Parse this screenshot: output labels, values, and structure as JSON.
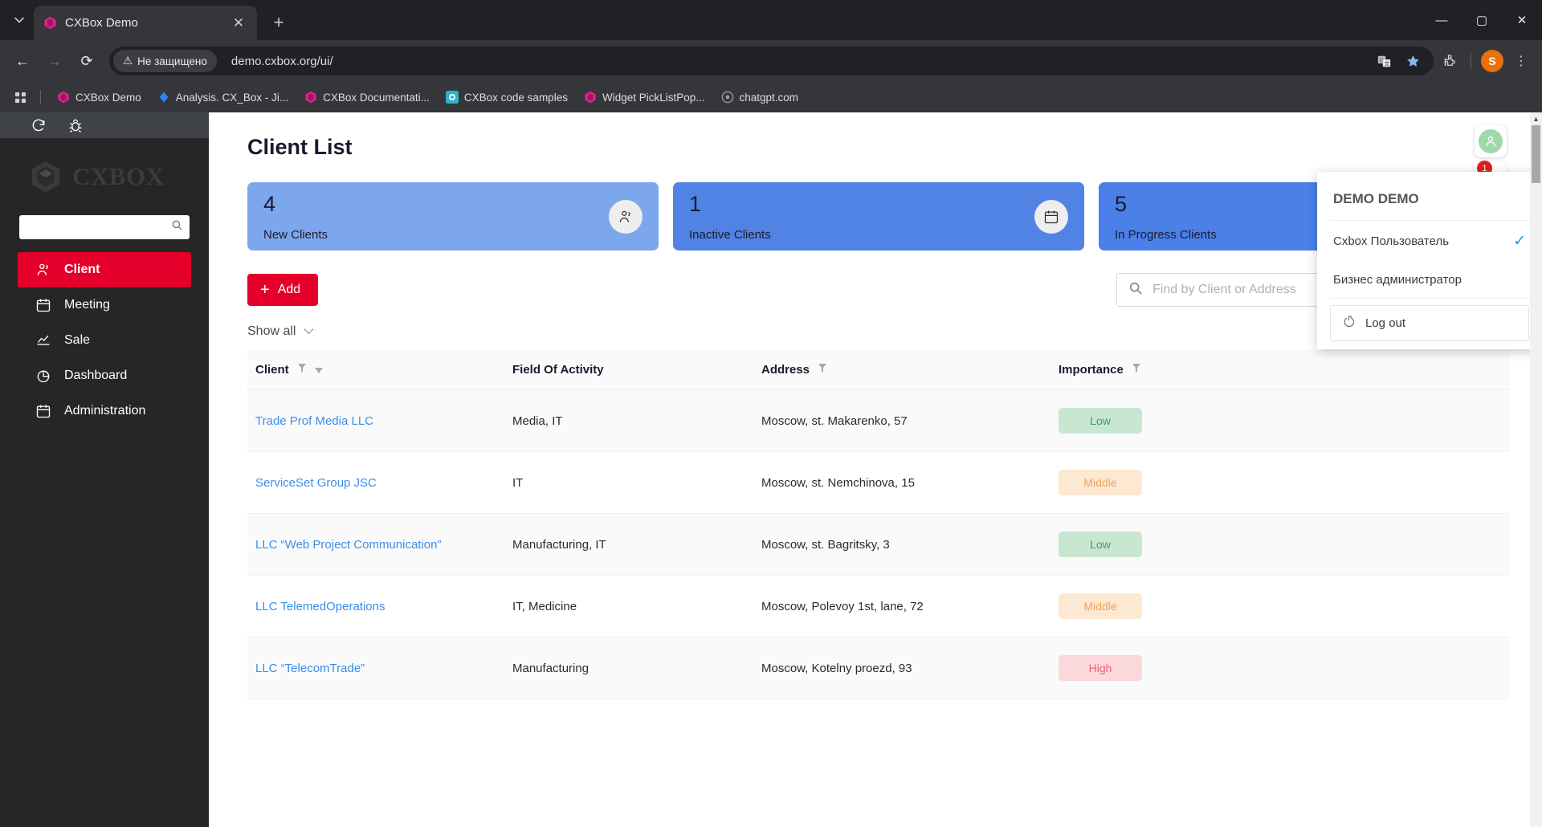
{
  "browser": {
    "tab": {
      "title": "CXBox Demo",
      "favicon": "cxbox-logo-icon"
    },
    "security_label": "Не защищено",
    "url": "demo.cxbox.org/ui/",
    "profile_initial": "S",
    "bookmarks": [
      {
        "label": "CXBox Demo",
        "icon": "cxbox-logo-icon",
        "color": "#e0218a"
      },
      {
        "label": "Analysis. CX_Box - Ji...",
        "icon": "jira-icon",
        "color": "#2684ff"
      },
      {
        "label": "CXBox Documentati...",
        "icon": "cxbox-logo-icon",
        "color": "#e0218a"
      },
      {
        "label": "CXBox code samples",
        "icon": "github-icon",
        "color": "#2fb3c9"
      },
      {
        "label": "Widget PickListPop...",
        "icon": "cxbox-logo-icon",
        "color": "#e0218a"
      },
      {
        "label": "chatgpt.com",
        "icon": "openai-icon",
        "color": "#5f6368"
      }
    ]
  },
  "sidebar": {
    "brand": "CXBOX",
    "top_icons": [
      "refresh-icon",
      "bug-icon"
    ],
    "search": {
      "value": "",
      "placeholder": ""
    },
    "items": [
      {
        "label": "Client",
        "icon": "people-icon",
        "active": true
      },
      {
        "label": "Meeting",
        "icon": "calendar-icon",
        "active": false
      },
      {
        "label": "Sale",
        "icon": "chart-line-icon",
        "active": false
      },
      {
        "label": "Dashboard",
        "icon": "pie-chart-icon",
        "active": false
      },
      {
        "label": "Administration",
        "icon": "calendar-icon",
        "active": false
      }
    ]
  },
  "main": {
    "title": "Client List",
    "cards": [
      {
        "value": "4",
        "label": "New Clients",
        "color": "#7da7ec",
        "icon": "people-icon"
      },
      {
        "value": "1",
        "label": "Inactive Clients",
        "color": "#5083e4",
        "icon": "calendar-icon"
      },
      {
        "value": "5",
        "label": "In Progress Clients",
        "color": "#4a80e8",
        "icon": "clock-icon"
      }
    ],
    "add_button": "Add",
    "search": {
      "value": "",
      "placeholder": "Find by Client or Address"
    },
    "show_all": "Show all",
    "table": {
      "columns": [
        {
          "label": "Client",
          "filter": true,
          "sort": true
        },
        {
          "label": "Field Of Activity",
          "filter": false,
          "sort": false
        },
        {
          "label": "Address",
          "filter": true,
          "sort": false
        },
        {
          "label": "Importance",
          "filter": true,
          "sort": false
        }
      ],
      "rows": [
        {
          "client": "Trade Prof Media LLC",
          "activity": "Media, IT",
          "address": "Moscow, st. Makarenko, 57",
          "importance": "Low",
          "level": "low"
        },
        {
          "client": "ServiceSet Group JSC",
          "activity": "IT",
          "address": "Moscow, st. Nemchinova, 15",
          "importance": "Middle",
          "level": "middle"
        },
        {
          "client": "LLC “Web Project Communication”",
          "activity": "Manufacturing, IT",
          "address": "Moscow, st. Bagritsky, 3",
          "importance": "Low",
          "level": "low"
        },
        {
          "client": "LLC TelemedOperations",
          "activity": "IT, Medicine",
          "address": "Moscow, Polevoy 1st, lane, 72",
          "importance": "Middle",
          "level": "middle"
        },
        {
          "client": "LLC “TelecomTrade”",
          "activity": "Manufacturing",
          "address": "Moscow, Kotelny proezd, 93",
          "importance": "High",
          "level": "high"
        }
      ]
    }
  },
  "user_menu": {
    "title": "DEMO DEMO",
    "roles": [
      {
        "label": "Cxbox Пользователь",
        "selected": true
      },
      {
        "label": "Бизнес администратор",
        "selected": false
      }
    ],
    "logout": "Log out",
    "notification_count": "1"
  },
  "colors": {
    "accent_red": "#e4002b",
    "link_blue": "#3a8ee6",
    "avatar_green": "#9fd8ab"
  }
}
